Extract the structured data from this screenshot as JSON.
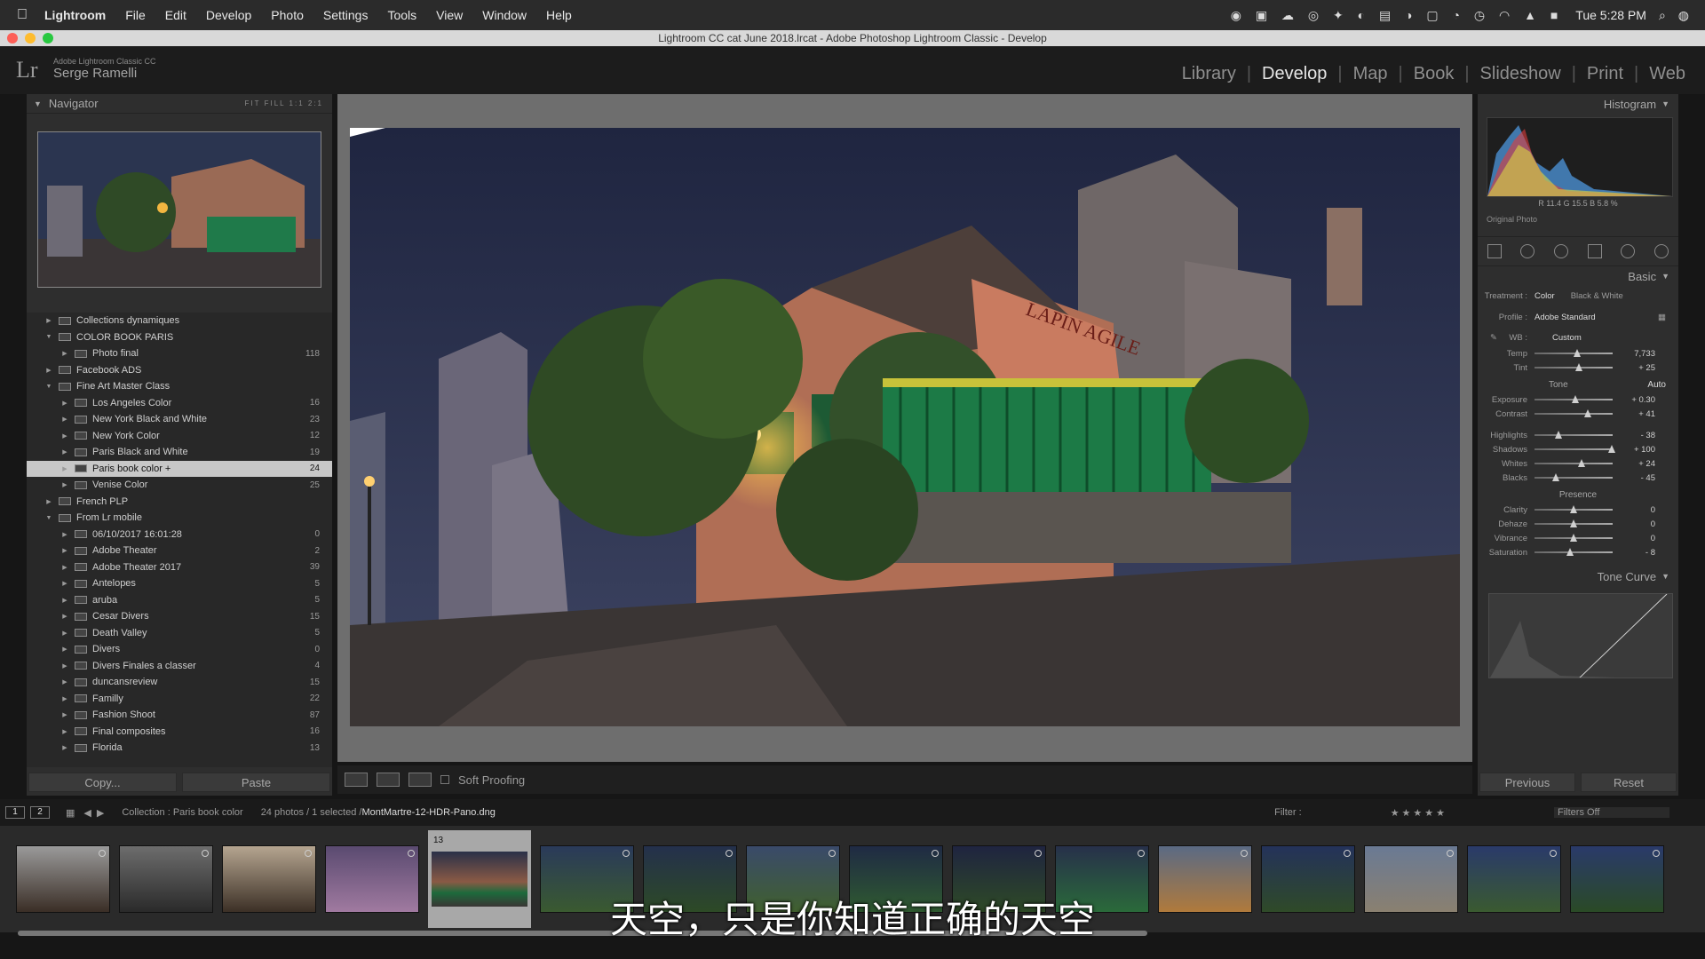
{
  "menubar": {
    "apple": "",
    "items": [
      "Lightroom",
      "File",
      "Edit",
      "Develop",
      "Photo",
      "Settings",
      "Tools",
      "View",
      "Window",
      "Help"
    ],
    "clock": "Tue 5:28 PM"
  },
  "window_title": "Lightroom CC cat June 2018.lrcat - Adobe Photoshop Lightroom Classic - Develop",
  "identity": {
    "logo": "Lr",
    "product": "Adobe Lightroom Classic CC",
    "user": "Serge Ramelli"
  },
  "modules": [
    "Library",
    "Develop",
    "Map",
    "Book",
    "Slideshow",
    "Print",
    "Web"
  ],
  "active_module": "Develop",
  "navigator": {
    "title": "Navigator",
    "options": "FIT  FILL  1:1  2:1"
  },
  "collections": [
    {
      "name": "Collections dynamiques",
      "count": "",
      "level": 1,
      "expanded": false
    },
    {
      "name": "COLOR BOOK PARIS",
      "count": "",
      "level": 1,
      "expanded": true
    },
    {
      "name": "Photo final",
      "count": "118",
      "level": 2,
      "expanded": false
    },
    {
      "name": "Facebook ADS",
      "count": "",
      "level": 1,
      "expanded": false
    },
    {
      "name": "Fine Art Master Class",
      "count": "",
      "level": 1,
      "expanded": true
    },
    {
      "name": "Los Angeles Color",
      "count": "16",
      "level": 2,
      "expanded": false
    },
    {
      "name": "New York Black and White",
      "count": "23",
      "level": 2,
      "expanded": false
    },
    {
      "name": "New York Color",
      "count": "12",
      "level": 2,
      "expanded": false
    },
    {
      "name": "Paris Black and White",
      "count": "19",
      "level": 2,
      "expanded": false
    },
    {
      "name": "Paris book color  +",
      "count": "24",
      "level": 2,
      "expanded": false,
      "selected": true
    },
    {
      "name": "Venise Color",
      "count": "25",
      "level": 2,
      "expanded": false
    },
    {
      "name": "French PLP",
      "count": "",
      "level": 1,
      "expanded": false
    },
    {
      "name": "From Lr mobile",
      "count": "",
      "level": 1,
      "expanded": true
    },
    {
      "name": "06/10/2017 16:01:28",
      "count": "0",
      "level": 2,
      "expanded": false
    },
    {
      "name": "Adobe Theater",
      "count": "2",
      "level": 2,
      "expanded": false
    },
    {
      "name": "Adobe Theater 2017",
      "count": "39",
      "level": 2,
      "expanded": false
    },
    {
      "name": "Antelopes",
      "count": "5",
      "level": 2,
      "expanded": false
    },
    {
      "name": "aruba",
      "count": "5",
      "level": 2,
      "expanded": false
    },
    {
      "name": "Cesar Divers",
      "count": "15",
      "level": 2,
      "expanded": false
    },
    {
      "name": "Death Valley",
      "count": "5",
      "level": 2,
      "expanded": false
    },
    {
      "name": "Divers",
      "count": "0",
      "level": 2,
      "expanded": false
    },
    {
      "name": "Divers Finales a classer",
      "count": "4",
      "level": 2,
      "expanded": false
    },
    {
      "name": "duncansreview",
      "count": "15",
      "level": 2,
      "expanded": false
    },
    {
      "name": "Familly",
      "count": "22",
      "level": 2,
      "expanded": false
    },
    {
      "name": "Fashion Shoot",
      "count": "87",
      "level": 2,
      "expanded": false
    },
    {
      "name": "Final composites",
      "count": "16",
      "level": 2,
      "expanded": false
    },
    {
      "name": "Florida",
      "count": "13",
      "level": 2,
      "expanded": false
    }
  ],
  "left_buttons": {
    "copy": "Copy...",
    "paste": "Paste"
  },
  "toolbar": {
    "soft_proofing": "Soft Proofing"
  },
  "histogram": {
    "title": "Histogram",
    "readout": "R  11.4  G  15.5  B  5.8 %",
    "original_photo": "Original Photo"
  },
  "basic": {
    "title": "Basic",
    "treatment_label": "Treatment :",
    "treatment_color": "Color",
    "treatment_bw": "Black & White",
    "profile_label": "Profile :",
    "profile_value": "Adobe Standard",
    "wb_label": "WB :",
    "wb_value": "Custom",
    "tone_label": "Tone",
    "auto": "Auto",
    "presence_label": "Presence",
    "sliders_wb": [
      {
        "name": "Temp",
        "value": "7,733",
        "pos": 0.55
      },
      {
        "name": "Tint",
        "value": "+ 25",
        "pos": 0.57
      }
    ],
    "sliders_tone": [
      {
        "name": "Exposure",
        "value": "+ 0.30",
        "pos": 0.52
      },
      {
        "name": "Contrast",
        "value": "+ 41",
        "pos": 0.68
      }
    ],
    "sliders_tone2": [
      {
        "name": "Highlights",
        "value": "- 38",
        "pos": 0.31
      },
      {
        "name": "Shadows",
        "value": "+ 100",
        "pos": 0.99
      },
      {
        "name": "Whites",
        "value": "+ 24",
        "pos": 0.6
      },
      {
        "name": "Blacks",
        "value": "- 45",
        "pos": 0.27
      }
    ],
    "sliders_presence": [
      {
        "name": "Clarity",
        "value": "0",
        "pos": 0.5
      },
      {
        "name": "Dehaze",
        "value": "0",
        "pos": 0.5
      },
      {
        "name": "Vibrance",
        "value": "0",
        "pos": 0.5
      },
      {
        "name": "Saturation",
        "value": "- 8",
        "pos": 0.46
      }
    ]
  },
  "tone_curve": {
    "title": "Tone Curve"
  },
  "right_buttons": {
    "previous": "Previous",
    "reset": "Reset"
  },
  "filmbar": {
    "box1": "1",
    "box2": "2",
    "collection": "Collection : Paris book color",
    "photos": "24 photos / 1 selected /",
    "filename": "MontMartre-12-HDR-Pano.dng",
    "filter_label": "Filter :",
    "filters_off": "Filters Off"
  },
  "filmstrip": {
    "selected_index_label": "13"
  },
  "subtitle": "天空，只是你知道正确的天空"
}
